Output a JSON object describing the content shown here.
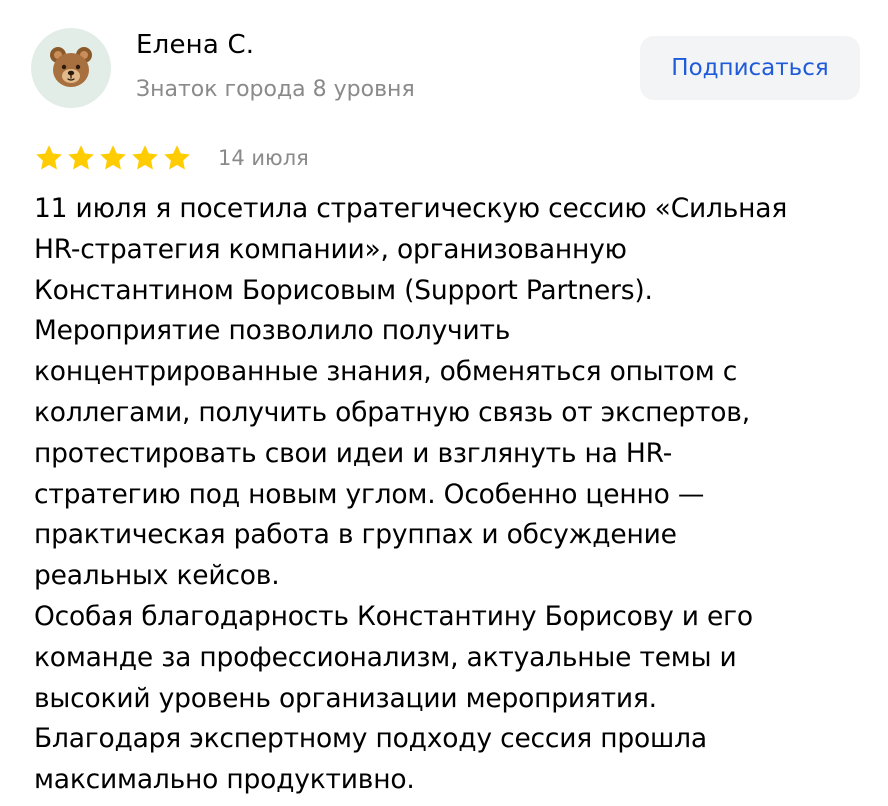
{
  "author": {
    "name": "Елена С.",
    "level": "Знаток города 8 уровня",
    "avatar_icon": "bear-emoji-icon",
    "avatar_glyph": "🐻"
  },
  "actions": {
    "subscribe_label": "Подписаться"
  },
  "rating": {
    "stars": 5,
    "max": 5,
    "star_color": "#FFCC00",
    "date": "14 июля"
  },
  "review": {
    "text": "11 июля я посетила стратегическую сессию «Сильная\nHR-стратегия компании», организованную\nКонстантином Борисовым (Support Partners).\nМероприятие позволило получить\nконцентрированные знания, обменяться опытом с\nколлегами, получить обратную связь от экспертов,\nпротестировать свои идеи и взглянуть на HR-\nстратегию под новым углом. Особенно ценно —\nпрактическая работа в группах и обсуждение\nреальных кейсов.\nОсобая благодарность Константину Борисову и его\nкоманде за профессионализм, актуальные темы и\nвысокий уровень организации мероприятия.\nБлагодаря экспертному подходу сессия прошла\nмаксимально продуктивно."
  },
  "colors": {
    "link_blue": "#1F5BD8",
    "secondary_text": "#8A8A8A",
    "button_bg": "#F2F4F6",
    "avatar_bg": "#E3EDE8"
  }
}
